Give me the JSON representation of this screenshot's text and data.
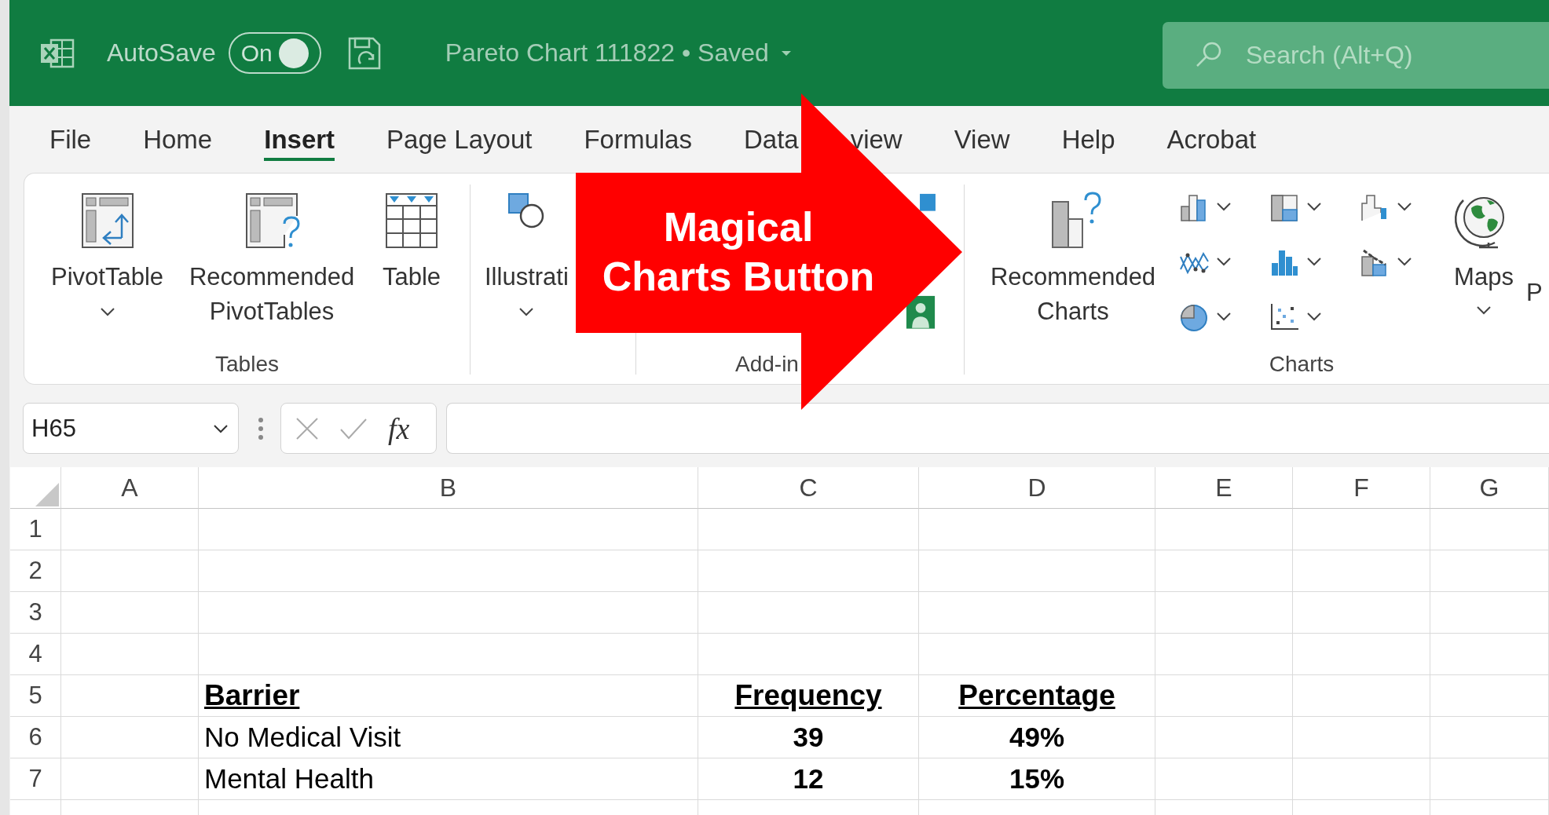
{
  "title_bar": {
    "autosave_label": "AutoSave",
    "autosave_toggle": {
      "label": "On",
      "on": true
    },
    "document_title": "Pareto Chart 111822 • Saved",
    "search": {
      "placeholder": "Search (Alt+Q)"
    }
  },
  "tabs": [
    {
      "label": "File",
      "selected": false
    },
    {
      "label": "Home",
      "selected": false
    },
    {
      "label": "Insert",
      "selected": true
    },
    {
      "label": "Page Layout",
      "selected": false
    },
    {
      "label": "Formulas",
      "selected": false
    },
    {
      "label": "Data",
      "selected": false
    },
    {
      "label": "view",
      "selected": false
    },
    {
      "label": "View",
      "selected": false
    },
    {
      "label": "Help",
      "selected": false
    },
    {
      "label": "Acrobat",
      "selected": false
    }
  ],
  "ribbon": {
    "groups": [
      {
        "kind": "tables",
        "label": "Tables",
        "buttons": [
          {
            "kind": "pivot_table",
            "label": "PivotTable",
            "dropdown": true
          },
          {
            "kind": "recommended_pivot",
            "label": "Recommended PivotTables",
            "dropdown": false
          },
          {
            "kind": "table",
            "label": "Table",
            "dropdown": false
          }
        ]
      },
      {
        "kind": "illustrations",
        "buttons": [
          {
            "kind": "illustrations",
            "label": "Illustrati",
            "dropdown": true
          }
        ]
      },
      {
        "kind": "addins",
        "label": "Add-in"
      },
      {
        "kind": "charts",
        "label": "Charts",
        "buttons": [
          {
            "kind": "recommended_charts",
            "label": "Recommended Charts",
            "dropdown": false
          },
          {
            "kind": "chart_grid"
          },
          {
            "kind": "maps",
            "label": "Maps",
            "dropdown": true
          },
          {
            "kind": "label_only",
            "label": "P",
            "dropdown": false
          }
        ]
      }
    ]
  },
  "formula_bar": {
    "name_box": "H65",
    "function_label": "fx"
  },
  "sheet": {
    "columns": [
      "A",
      "B",
      "C",
      "D",
      "E",
      "F",
      "G"
    ],
    "rows": [
      {
        "number": "1"
      },
      {
        "number": "2"
      },
      {
        "number": "3"
      },
      {
        "number": "4"
      },
      {
        "number": "5",
        "cells": [
          null,
          {
            "kind": "label_heading",
            "text": "Barrier"
          },
          {
            "kind": "value_heading",
            "text": "Frequency"
          },
          {
            "kind": "value_heading",
            "text": "Percentage"
          }
        ]
      },
      {
        "number": "6",
        "cells": [
          null,
          {
            "kind": "label",
            "text": "No Medical Visit"
          },
          {
            "kind": "value",
            "text": "39"
          },
          {
            "kind": "value",
            "text": "49%"
          }
        ]
      },
      {
        "number": "7",
        "cells": [
          null,
          {
            "kind": "label",
            "text": "Mental Health"
          },
          {
            "kind": "value",
            "text": "12"
          },
          {
            "kind": "value",
            "text": "15%"
          }
        ]
      }
    ]
  },
  "callout": {
    "lines": [
      "Magical",
      "Charts Button"
    ]
  }
}
